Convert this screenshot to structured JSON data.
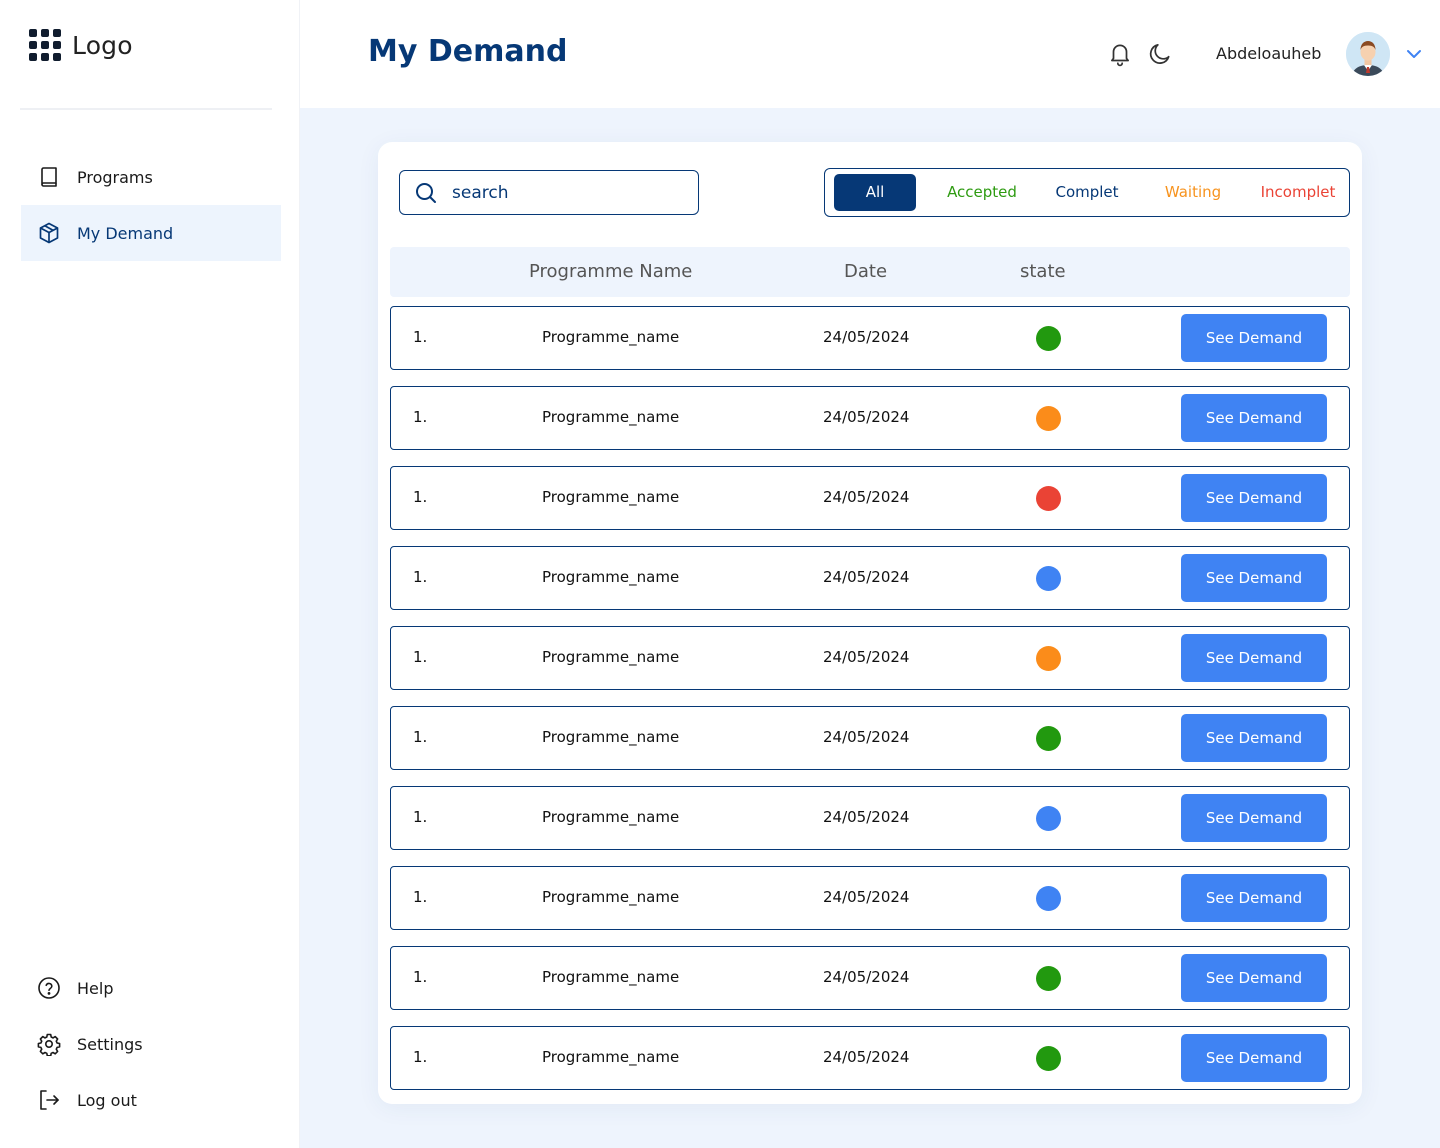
{
  "brand": {
    "logo_text": "Logo"
  },
  "sidebar": {
    "items": [
      {
        "label": "Programs",
        "icon": "book-icon",
        "active": false
      },
      {
        "label": "My Demand",
        "icon": "box-icon",
        "active": true
      }
    ],
    "bottom_items": [
      {
        "label": "Help",
        "icon": "help-circle-icon"
      },
      {
        "label": "Settings",
        "icon": "gear-icon"
      },
      {
        "label": "Log out",
        "icon": "logout-icon"
      }
    ]
  },
  "header": {
    "title": "My Demand",
    "username": "Abdeloauheb",
    "icons": [
      "bell-icon",
      "moon-icon",
      "chevron-down-icon"
    ]
  },
  "search": {
    "placeholder": "search",
    "value": ""
  },
  "filters": [
    {
      "label": "All",
      "color": "#ffffff",
      "active": true
    },
    {
      "label": "Accepted",
      "color": "#2e9b11"
    },
    {
      "label": "Complet",
      "color": "#063876"
    },
    {
      "label": "Waiting",
      "color": "#f7931e"
    },
    {
      "label": "Incomplet",
      "color": "#ea4335"
    }
  ],
  "table": {
    "columns": [
      "Programme Name",
      "Date",
      "state"
    ],
    "button_label": "See Demand",
    "state_colors": {
      "accepted": "#22990f",
      "waiting": "#fb8c1a",
      "incomplet": "#ea4335",
      "complet": "#3f83f3"
    },
    "rows": [
      {
        "index": "1.",
        "name": "Programme_name",
        "date": "24/05/2024",
        "state": "accepted"
      },
      {
        "index": "1.",
        "name": "Programme_name",
        "date": "24/05/2024",
        "state": "waiting"
      },
      {
        "index": "1.",
        "name": "Programme_name",
        "date": "24/05/2024",
        "state": "incomplet"
      },
      {
        "index": "1.",
        "name": "Programme_name",
        "date": "24/05/2024",
        "state": "complet"
      },
      {
        "index": "1.",
        "name": "Programme_name",
        "date": "24/05/2024",
        "state": "waiting"
      },
      {
        "index": "1.",
        "name": "Programme_name",
        "date": "24/05/2024",
        "state": "accepted"
      },
      {
        "index": "1.",
        "name": "Programme_name",
        "date": "24/05/2024",
        "state": "complet"
      },
      {
        "index": "1.",
        "name": "Programme_name",
        "date": "24/05/2024",
        "state": "complet"
      },
      {
        "index": "1.",
        "name": "Programme_name",
        "date": "24/05/2024",
        "state": "accepted"
      },
      {
        "index": "1.",
        "name": "Programme_name",
        "date": "24/05/2024",
        "state": "accepted"
      }
    ]
  },
  "colors": {
    "primary": "#063876",
    "accent": "#3f83f3",
    "background": "#eef4fd"
  }
}
